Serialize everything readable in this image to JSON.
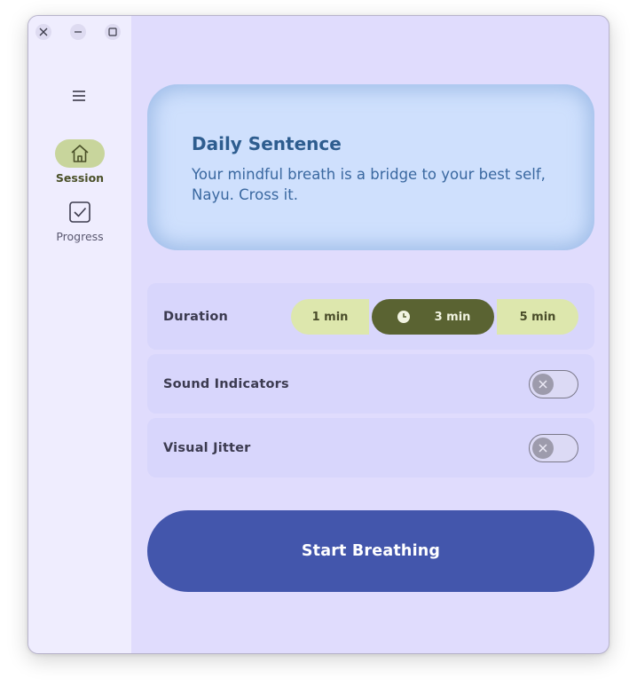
{
  "window_controls": {
    "close": "close",
    "minimize": "minimize",
    "maximize": "maximize"
  },
  "sidebar": {
    "items": [
      {
        "label": "Session",
        "icon": "home-icon",
        "active": true
      },
      {
        "label": "Progress",
        "icon": "checkbox-icon",
        "active": false
      }
    ]
  },
  "daily": {
    "title": "Daily Sentence",
    "text": "Your mindful breath is a bridge to your best self, Nayu. Cross it."
  },
  "duration": {
    "label": "Duration",
    "options": [
      "1 min",
      "3 min",
      "5 min"
    ],
    "selected": "3 min"
  },
  "sound_indicators": {
    "label": "Sound Indicators",
    "enabled": false
  },
  "visual_jitter": {
    "label": "Visual Jitter",
    "enabled": false
  },
  "start_button": {
    "label": "Start Breathing"
  },
  "colors": {
    "background": "#e0dcfd",
    "sidebar": "#efedfe",
    "accent": "#4356ac",
    "nav_active": "#c8d59c",
    "segment_active": "#5a6332",
    "segment": "#dde7ad",
    "card": "#cfe0fd"
  }
}
